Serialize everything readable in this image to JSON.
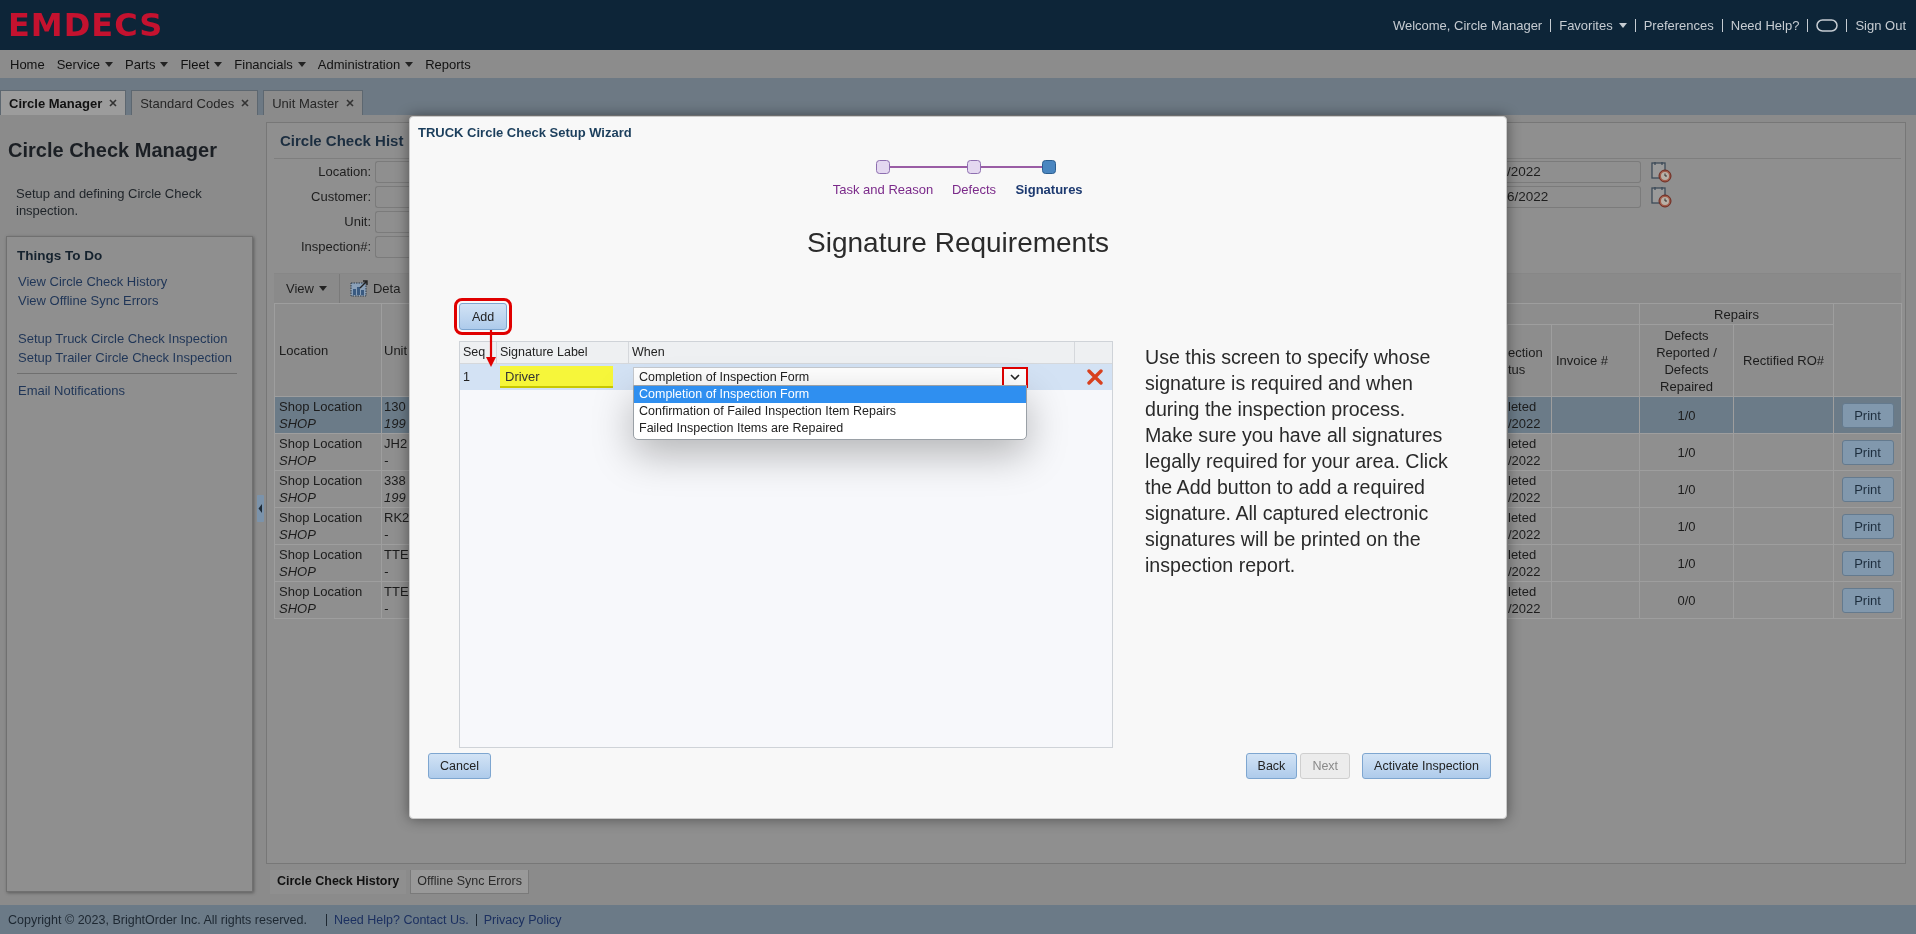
{
  "header": {
    "logo": "EMDECS",
    "items": [
      {
        "kind": "text",
        "label": "Welcome, Circle Manager"
      },
      {
        "kind": "menu",
        "label": "Favorites"
      },
      {
        "kind": "link",
        "label": "Preferences"
      },
      {
        "kind": "link",
        "label": "Need Help?"
      },
      {
        "kind": "toggle"
      },
      {
        "kind": "link",
        "label": "Sign Out"
      }
    ]
  },
  "menu": [
    {
      "label": "Home",
      "has_menu": false
    },
    {
      "label": "Service",
      "has_menu": true
    },
    {
      "label": "Parts",
      "has_menu": true
    },
    {
      "label": "Fleet",
      "has_menu": true
    },
    {
      "label": "Financials",
      "has_menu": true
    },
    {
      "label": "Administration",
      "has_menu": true
    },
    {
      "label": "Reports",
      "has_menu": false
    }
  ],
  "tabs": [
    {
      "label": "Circle Manager",
      "selected": true
    },
    {
      "label": "Standard Codes",
      "selected": false
    },
    {
      "label": "Unit Master",
      "selected": false
    }
  ],
  "sidebar": {
    "title": "Circle Check Manager",
    "description": "Setup and defining Circle Check inspection.",
    "todo_title": "Things To Do",
    "link_groups": [
      {
        "rule_above": false,
        "links": [
          "View Circle Check History",
          "View Offline Sync Errors"
        ]
      },
      {
        "rule_above": false,
        "links": [
          "Setup Truck Circle Check Inspection",
          "Setup Trailer Circle Check Inspection"
        ]
      },
      {
        "rule_above": true,
        "links": [
          "Email Notifications"
        ]
      }
    ]
  },
  "history": {
    "title": "Circle Check Hist",
    "filters": [
      "Location:",
      "Customer:",
      "Unit:",
      "Inspection#:"
    ],
    "dates": [
      "/2022",
      "6/2022"
    ],
    "toolbar": {
      "view": "View",
      "details": "Deta"
    },
    "table": {
      "group_header": "Repairs",
      "columns": {
        "location": "Location",
        "unit": "Unit",
        "status": "ection\ntus",
        "invoice": "Invoice #",
        "defects": "Defects Reported / Defects Repaired",
        "rectified": "Rectified RO#"
      },
      "rows": [
        {
          "location": "Shop Location",
          "code": "SHOP",
          "unit": "130",
          "unit_detail": "199",
          "status": "leted",
          "status_date": "/2022",
          "defects": "1/0",
          "action": "Print",
          "selected": true
        },
        {
          "location": "Shop Location",
          "code": "SHOP",
          "unit": "JH2",
          "unit_detail": "-",
          "status": "leted",
          "status_date": "/2022",
          "defects": "1/0",
          "action": "Print",
          "selected": false
        },
        {
          "location": "Shop Location",
          "code": "SHOP",
          "unit": "338",
          "unit_detail": "199",
          "status": "leted",
          "status_date": "/2022",
          "defects": "1/0",
          "action": "Print",
          "selected": false
        },
        {
          "location": "Shop Location",
          "code": "SHOP",
          "unit": "RK2",
          "unit_detail": "-",
          "status": "leted",
          "status_date": "/2022",
          "defects": "1/0",
          "action": "Print",
          "selected": false
        },
        {
          "location": "Shop Location",
          "code": "SHOP",
          "unit": "TTE",
          "unit_detail": "-",
          "status": "leted",
          "status_date": "/2022",
          "defects": "1/0",
          "action": "Print",
          "selected": false
        },
        {
          "location": "Shop Location",
          "code": "SHOP",
          "unit": "TTE",
          "unit_detail": "-",
          "status": "leted",
          "status_date": "/2022",
          "defects": "0/0",
          "action": "Print",
          "selected": false
        }
      ]
    },
    "bottom_tabs": [
      {
        "label": "Circle Check History",
        "selected": true
      },
      {
        "label": "Offline Sync Errors",
        "selected": false
      }
    ]
  },
  "dialog": {
    "title": "TRUCK Circle Check Setup Wizard",
    "steps": [
      {
        "label": "Task and Reason",
        "selected": false
      },
      {
        "label": "Defects",
        "selected": false
      },
      {
        "label": "Signatures",
        "selected": true
      }
    ],
    "heading": "Signature Requirements",
    "add_button": {
      "label": "Add",
      "highlighted": true
    },
    "callout_arrow": true,
    "grid": {
      "columns": [
        "Seq",
        "Signature Label",
        "When"
      ],
      "rows": [
        {
          "seq": "1",
          "label": "Driver",
          "when": "Completion of Inspection Form",
          "selected": true,
          "arrow_highlighted": true,
          "dropdown_open": true,
          "options": [
            {
              "label": "Completion of Inspection Form",
              "selected": true
            },
            {
              "label": "Confirmation of Failed Inspection Item Repairs",
              "selected": false
            },
            {
              "label": "Failed Inspection Items are Repaired",
              "selected": false
            }
          ]
        }
      ]
    },
    "help": "Use this screen to specify whose signature is required and when during the inspection process. Make sure you have all signatures legally required for your area. Click the Add button to add a required signature. All captured electronic signatures will be printed on the inspection report.",
    "buttons": [
      {
        "label": "Cancel",
        "disabled": false
      },
      {
        "label": "Back",
        "disabled": false
      },
      {
        "label": "Next",
        "disabled": true
      },
      {
        "label": "Activate Inspection",
        "disabled": false
      }
    ]
  },
  "footer": {
    "copyright": "Copyright © 2023, BrightOrder Inc. All rights reserved.",
    "links": [
      "Need Help? Contact Us.",
      "Privacy Policy"
    ]
  }
}
